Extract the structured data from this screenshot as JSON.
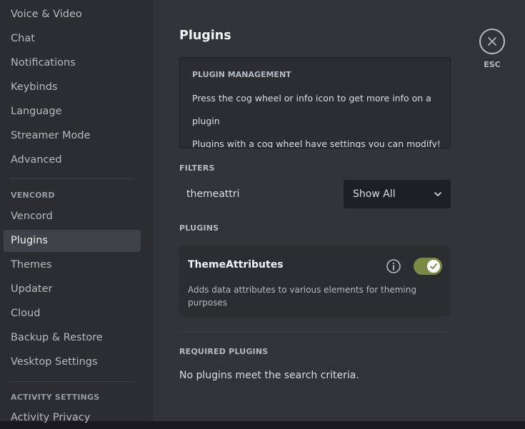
{
  "sidebar": {
    "items_top": [
      {
        "label": "Voice & Video"
      },
      {
        "label": "Chat"
      },
      {
        "label": "Notifications"
      },
      {
        "label": "Keybinds"
      },
      {
        "label": "Language"
      },
      {
        "label": "Streamer Mode"
      },
      {
        "label": "Advanced"
      }
    ],
    "vencord_section": "VENCORD",
    "items_vencord": [
      {
        "label": "Vencord"
      },
      {
        "label": "Plugins"
      },
      {
        "label": "Themes"
      },
      {
        "label": "Updater"
      },
      {
        "label": "Cloud"
      },
      {
        "label": "Backup & Restore"
      },
      {
        "label": "Vesktop Settings"
      }
    ],
    "activity_section": "ACTIVITY SETTINGS",
    "items_activity": [
      {
        "label": "Activity Privacy"
      }
    ]
  },
  "main": {
    "title": "Plugins",
    "info_card": {
      "heading": "PLUGIN MANAGEMENT",
      "line1": "Press the cog wheel or info icon to get more info on a",
      "line2": "plugin",
      "line3": "Plugins with a cog wheel have settings you can modify!"
    },
    "filters_label": "FILTERS",
    "search_value": "themeattri",
    "select_value": "Show All",
    "plugins_label": "PLUGINS",
    "plugin": {
      "name": "ThemeAttributes",
      "description": "Adds data attributes to various elements for theming purposes",
      "enabled": true
    },
    "required_label": "REQUIRED PLUGINS",
    "required_empty": "No plugins meet the search criteria.",
    "close_label": "ESC"
  },
  "colors": {
    "accent_toggle": "#7a8a45",
    "sidebar_bg": "#2b2d31",
    "main_bg": "#313338"
  }
}
